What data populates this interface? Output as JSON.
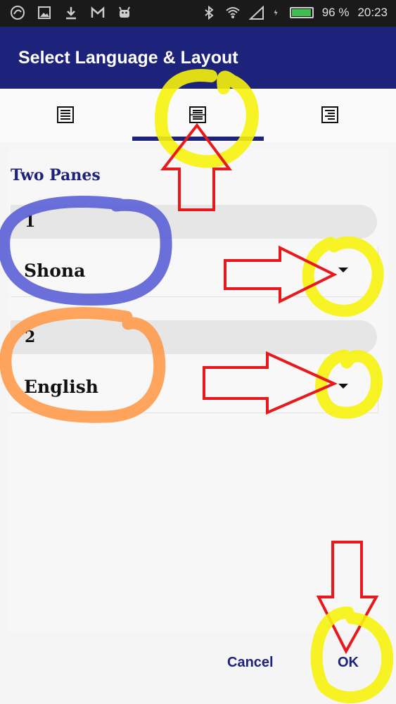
{
  "status_bar": {
    "battery_percent": "96 %",
    "time": "20:23",
    "battery_level": 0.96,
    "left_icons": [
      "app-icon",
      "image-icon",
      "download-icon",
      "gmail-icon",
      "android-icon"
    ],
    "right_icons": [
      "bluetooth-icon",
      "wifi-icon",
      "signal-icon",
      "charging-icon",
      "battery-icon"
    ]
  },
  "app_bar": {
    "title": "Select Language & Layout"
  },
  "tabs": [
    {
      "icon": "single-pane-icon",
      "selected": false
    },
    {
      "icon": "two-panes-icon",
      "selected": true
    },
    {
      "icon": "interlinear-icon",
      "selected": false
    }
  ],
  "section": {
    "title": "Two Panes"
  },
  "panes": [
    {
      "number": "1",
      "language": "Shona"
    },
    {
      "number": "2",
      "language": "English"
    }
  ],
  "buttons": {
    "cancel": "Cancel",
    "ok": "OK"
  },
  "colors": {
    "primary": "#1d237a",
    "annotation_yellow": "#f6f20c",
    "annotation_red": "#e8181c",
    "annotation_blue": "#5b5fd6",
    "annotation_orange": "#ff9a4a"
  }
}
